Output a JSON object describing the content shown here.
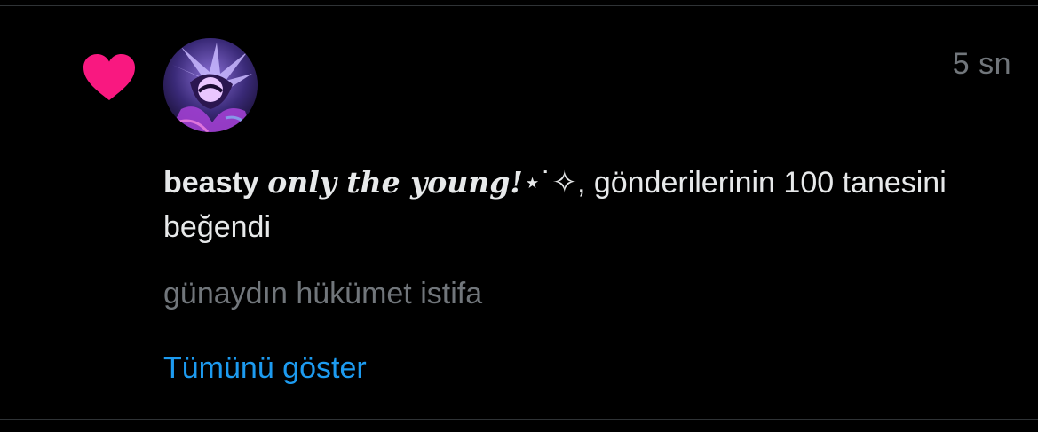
{
  "notification": {
    "icon": "heart-icon",
    "icon_color": "#f91880",
    "avatar": "user-avatar",
    "timestamp": "5 sn",
    "username": "beasty",
    "display_name": "only the young!",
    "display_name_decoration": "⋆˙✧",
    "action_text": ", gönderilerinin 100 tanesini beğendi",
    "tweet_preview": "günaydın hükümet istifa",
    "show_all_label": "Tümünü göster",
    "link_color": "#1d9bf0"
  }
}
